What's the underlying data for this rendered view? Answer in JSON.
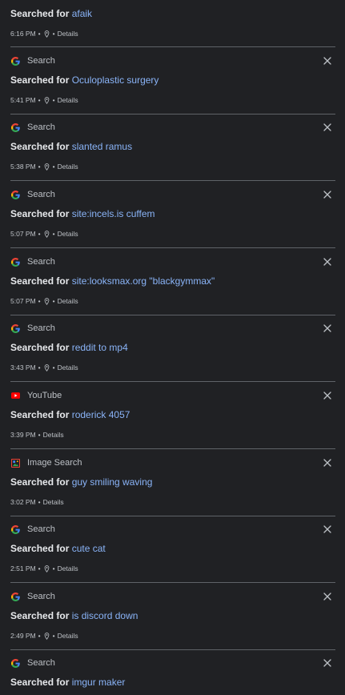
{
  "searched_prefix": "Searched for",
  "details_label": "Details",
  "items": [
    {
      "product": "",
      "query": "afaik",
      "time": "6:16 PM",
      "has_location": true,
      "icon": "none"
    },
    {
      "product": "Search",
      "query": "Oculoplastic surgery",
      "time": "5:41 PM",
      "has_location": true,
      "icon": "google-icon"
    },
    {
      "product": "Search",
      "query": "slanted ramus",
      "time": "5:38 PM",
      "has_location": true,
      "icon": "google-icon"
    },
    {
      "product": "Search",
      "query": "site:incels.is cuffem",
      "time": "5:07 PM",
      "has_location": true,
      "icon": "google-icon"
    },
    {
      "product": "Search",
      "query": "site:looksmax.org \"blackgymmax\"",
      "time": "5:07 PM",
      "has_location": true,
      "icon": "google-icon"
    },
    {
      "product": "Search",
      "query": "reddit to mp4",
      "time": "3:43 PM",
      "has_location": true,
      "icon": "google-icon"
    },
    {
      "product": "YouTube",
      "query": "roderick 4057",
      "time": "3:39 PM",
      "has_location": false,
      "icon": "youtube-icon"
    },
    {
      "product": "Image Search",
      "query": "guy smiling waving",
      "time": "3:02 PM",
      "has_location": false,
      "icon": "image-search-icon"
    },
    {
      "product": "Search",
      "query": "cute cat",
      "time": "2:51 PM",
      "has_location": true,
      "icon": "google-icon"
    },
    {
      "product": "Search",
      "query": "is discord down",
      "time": "2:49 PM",
      "has_location": true,
      "icon": "google-icon"
    },
    {
      "product": "Search",
      "query": "imgur maker",
      "time": "",
      "has_location": false,
      "icon": "google-icon"
    }
  ],
  "colors": {
    "background": "#202124",
    "divider": "#5f6368",
    "link": "#8ab4f8",
    "text": "#e8eaed",
    "secondary": "#bdc1c6",
    "youtube_red": "#ff0000"
  }
}
